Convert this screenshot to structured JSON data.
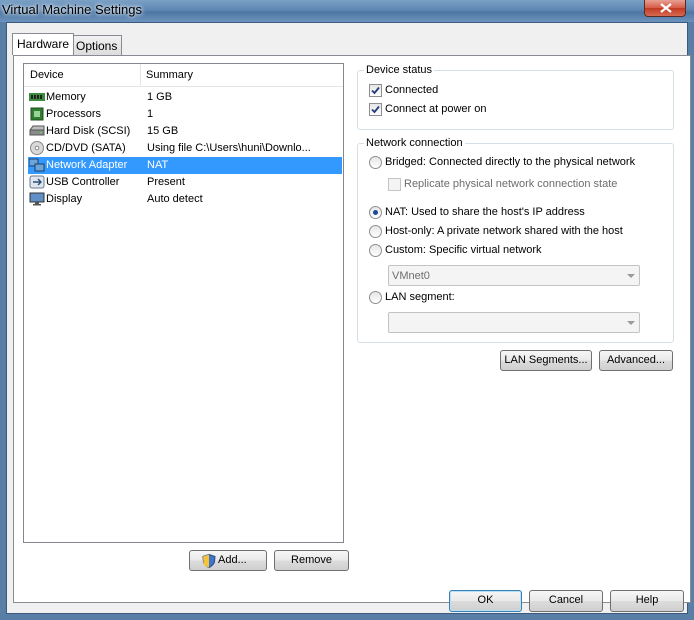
{
  "window": {
    "title": "Virtual Machine Settings"
  },
  "tabs": [
    {
      "label": "Hardware",
      "active": true
    },
    {
      "label": "Options",
      "active": false
    }
  ],
  "device_list": {
    "columns": [
      "Device",
      "Summary"
    ],
    "rows": [
      {
        "icon": "memory-icon",
        "device": "Memory",
        "summary": "1 GB"
      },
      {
        "icon": "processor-icon",
        "device": "Processors",
        "summary": "1"
      },
      {
        "icon": "hard-disk-icon",
        "device": "Hard Disk (SCSI)",
        "summary": "15 GB"
      },
      {
        "icon": "cd-dvd-icon",
        "device": "CD/DVD (SATA)",
        "summary": "Using file C:\\Users\\huni\\Downlo..."
      },
      {
        "icon": "network-adapter-icon",
        "device": "Network Adapter",
        "summary": "NAT",
        "selected": true
      },
      {
        "icon": "usb-icon",
        "device": "USB Controller",
        "summary": "Present"
      },
      {
        "icon": "display-icon",
        "device": "Display",
        "summary": "Auto detect"
      }
    ]
  },
  "buttons": {
    "add": "Add...",
    "remove": "Remove",
    "lan_segments": "LAN Segments...",
    "advanced": "Advanced...",
    "ok": "OK",
    "cancel": "Cancel",
    "help": "Help"
  },
  "device_status": {
    "legend": "Device status",
    "connected": {
      "label": "Connected",
      "checked": true
    },
    "connect_at_power_on": {
      "label": "Connect at power on",
      "checked": true
    }
  },
  "network_connection": {
    "legend": "Network connection",
    "bridged": {
      "label": "Bridged: Connected directly to the physical network",
      "selected": false
    },
    "replicate": {
      "label": "Replicate physical network connection state",
      "checked": false,
      "enabled": false
    },
    "nat": {
      "label": "NAT: Used to share the host's IP address",
      "selected": true
    },
    "host_only": {
      "label": "Host-only: A private network shared with the host",
      "selected": false
    },
    "custom": {
      "label": "Custom: Specific virtual network",
      "selected": false
    },
    "custom_vmnet": {
      "value": "VMnet0",
      "enabled": false
    },
    "lan_segment": {
      "label": "LAN segment:",
      "selected": false
    },
    "lan_segment_select": {
      "value": "",
      "enabled": false
    }
  },
  "colors": {
    "selection": "#3399ff",
    "title_bar": "#5f87b2",
    "close_button": "#c13a22"
  }
}
